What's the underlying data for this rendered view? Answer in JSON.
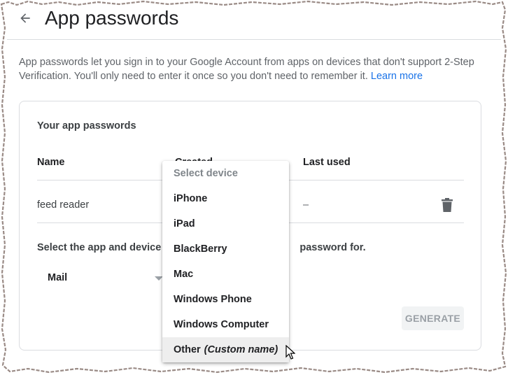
{
  "header": {
    "title": "App passwords",
    "back_icon": "arrow-left-icon"
  },
  "intro": {
    "text": "App passwords let you sign in to your Google Account from apps on devices that don't support 2-Step Verification. You'll only need to enter it once so you don't need to remember it.",
    "link": "Learn more"
  },
  "card": {
    "title": "Your app passwords",
    "columns": {
      "name": "Name",
      "created": "Created",
      "last_used": "Last used"
    },
    "rows": [
      {
        "name": "feed reader",
        "last_used": "–"
      }
    ],
    "select_prompt_start": "Select the app and device y",
    "select_prompt_end": "password for.",
    "app_select": {
      "value": "Mail"
    },
    "generate_label": "GENERATE"
  },
  "device_menu": {
    "header": "Select device",
    "items": [
      "iPhone",
      "iPad",
      "BlackBerry",
      "Mac",
      "Windows Phone",
      "Windows Computer"
    ],
    "other": {
      "label": "Other",
      "hint": "(Custom name)"
    }
  },
  "colors": {
    "link": "#1a73e8",
    "border": "#dadce0",
    "muted": "#5f6368"
  }
}
